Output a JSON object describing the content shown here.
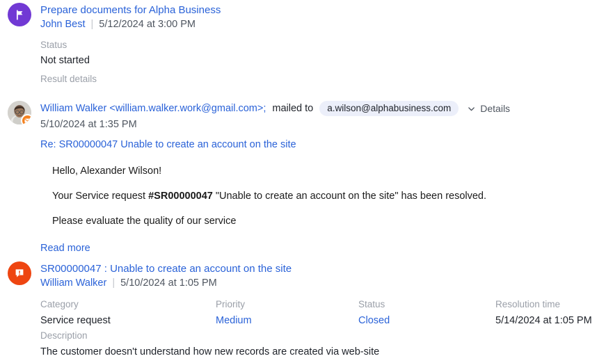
{
  "entries": {
    "task": {
      "icon": "flag-icon",
      "icon_color": "#7139d4",
      "title": "Prepare documents for Alpha Business",
      "author": "John Best",
      "separator": "|",
      "date": "5/12/2024 at 3:00 PM",
      "fields": {
        "status_label": "Status",
        "status_value": "Not started",
        "result_label": "Result details"
      }
    },
    "email": {
      "icon": "envelope-badge-icon",
      "icon_color": "#f58220",
      "avatar": "contact-photo",
      "from": "William Walker <william.walker.work@gmail.com>;",
      "mailed_to_label": "mailed to",
      "recipient_chip": "a.wilson@alphabusiness.com",
      "details_label": "Details",
      "date": "5/10/2024 at 1:35 PM",
      "subject": "Re: SR00000047 Unable to create an account on the site",
      "body": {
        "greeting": "Hello, Alexander Wilson!",
        "line2_pre": "Your Service request ",
        "line2_bold": "#SR00000047",
        "line2_post": " \"Unable to create an account on the site\" has been resolved.",
        "line3": "Please evaluate the quality of our service"
      },
      "read_more_label": "Read more"
    },
    "case": {
      "icon": "case-alert-icon",
      "icon_color": "#ee4511",
      "title": "SR00000047 : Unable to create an account on the site",
      "author": "William Walker",
      "separator": "|",
      "date": "5/10/2024 at 1:05 PM",
      "columns": [
        {
          "label": "Category",
          "value": "Service request",
          "is_link": false
        },
        {
          "label": "Priority",
          "value": "Medium",
          "is_link": true
        },
        {
          "label": "Status",
          "value": "Closed",
          "is_link": true
        },
        {
          "label": "Resolution time",
          "value": "5/14/2024 at 1:05 PM",
          "is_link": false
        }
      ],
      "description_label": "Description",
      "description_value": "The customer doesn't understand how new records are created via web-site"
    }
  },
  "colors": {
    "link": "#2a62d8",
    "label": "#9a9fa8",
    "text": "#20242b",
    "chip_bg": "#eceffa",
    "task_avatar": "#7139d4",
    "case_avatar": "#ee4511",
    "mail_badge": "#f58220"
  }
}
